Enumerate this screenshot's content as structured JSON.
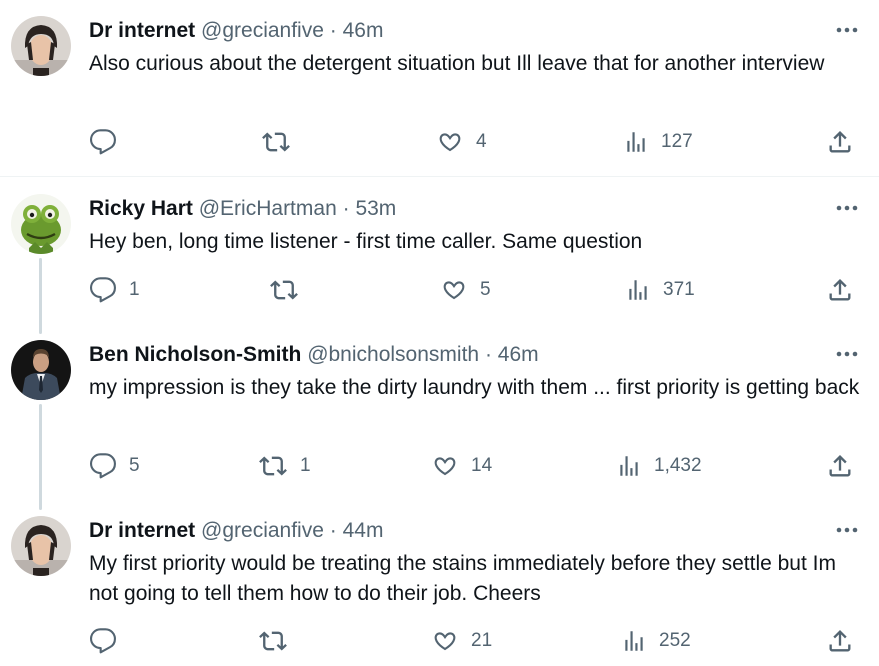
{
  "colors": {
    "text": "#0f1419",
    "secondary": "#536471",
    "divider": "#eff3f4",
    "thread_line": "#cfd9de"
  },
  "tweets": [
    {
      "name": "Dr internet",
      "handle": "@grecianfive",
      "separator": "·",
      "time": "46m",
      "text": "Also curious about the detergent situation but Ill leave that for another interview",
      "replies": "",
      "retweets": "",
      "likes": "4",
      "views": "127",
      "avatar_icon": "avatar-dark-hair-man"
    },
    {
      "name": "Ricky Hart",
      "handle": "@EricHartman",
      "separator": "·",
      "time": "53m",
      "text": "Hey ben, long time listener - first time caller. Same question",
      "replies": "1",
      "retweets": "",
      "likes": "5",
      "views": "371",
      "avatar_icon": "avatar-green-frog"
    },
    {
      "name": "Ben Nicholson-Smith",
      "handle": "@bnicholsonsmith",
      "separator": "·",
      "time": "46m",
      "text": "my impression is they take the dirty laundry with them ... first priority is getting back",
      "replies": "5",
      "retweets": "1",
      "likes": "14",
      "views": "1,432",
      "avatar_icon": "avatar-man-in-suit"
    },
    {
      "name": "Dr internet",
      "handle": "@grecianfive",
      "separator": "·",
      "time": "44m",
      "text": "My first priority would be treating the stains immediately before they settle but Im not going to tell them how to do their job. Cheers",
      "replies": "",
      "retweets": "",
      "likes": "21",
      "views": "252",
      "avatar_icon": "avatar-dark-hair-man"
    }
  ]
}
